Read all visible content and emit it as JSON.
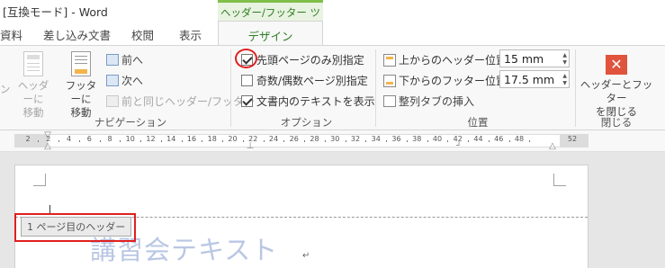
{
  "window": {
    "title": "[互換モード] - Word"
  },
  "contextual_group": "ヘッダー/フッター ツール",
  "tabs": [
    "資料",
    "差し込み文書",
    "校閲",
    "表示",
    "デザイン"
  ],
  "navigation": {
    "go_to_header_line1": "ヘッダーに",
    "go_to_header_line2": "移動",
    "go_to_footer_line1": "フッターに",
    "go_to_footer_line2": "移動",
    "previous": "前へ",
    "next": "次へ",
    "link_to_previous": "前と同じヘッダー/フッター",
    "group_label": "ナビゲーション"
  },
  "options": {
    "different_first_page": {
      "label": "先頭ページのみ別指定",
      "checked": true
    },
    "different_odd_even": {
      "label": "奇数/偶数ページ別指定",
      "checked": false
    },
    "show_document_text": {
      "label": "文書内のテキストを表示",
      "checked": true
    },
    "group_label": "オプション"
  },
  "position": {
    "header_from_top_label": "上からのヘッダー位置:",
    "header_from_top_value": "15 mm",
    "footer_from_bottom_label": "下からのフッター位置:",
    "footer_from_bottom_value": "17.5 mm",
    "insert_alignment_tab": "整列タブの挿入",
    "group_label": "位置"
  },
  "close": {
    "button_line1": "ヘッダーとフッター",
    "button_line2": "を閉じる",
    "group_label": "閉じる"
  },
  "left_partial": {
    "label": "ン"
  },
  "ruler": {
    "ticks": [
      "2",
      "2",
      "4",
      "6",
      "8",
      "10",
      "12",
      "14",
      "16",
      "18",
      "20",
      "22",
      "24",
      "26",
      "28",
      "30",
      "32",
      "34",
      "36",
      "38",
      "40",
      "42",
      "44",
      "46",
      "48",
      "52"
    ]
  },
  "document": {
    "header_tag": "1 ページ目のヘッダー",
    "watermark": "講習会テキスト"
  },
  "colors": {
    "contextual_green": "#2d7d23",
    "close_red": "#e0533d",
    "annotation_red": "#e02020",
    "watermark_blue": "#b9c7e4"
  }
}
